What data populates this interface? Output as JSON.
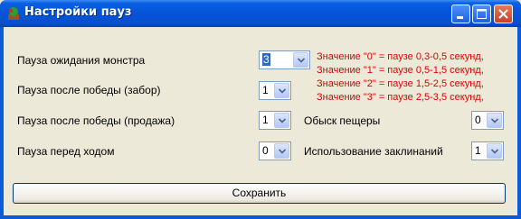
{
  "window": {
    "title": "Настройки пауз"
  },
  "settings": [
    {
      "label": "Пауза ожидания монстра",
      "value": "3"
    },
    {
      "label": "Пауза после победы (забор)",
      "value": "1"
    },
    {
      "label": "Пауза после победы (продажа)",
      "value": "1"
    },
    {
      "label": "Пауза перед ходом",
      "value": "0"
    },
    {
      "label": "Обыск пещеры",
      "value": "0"
    },
    {
      "label": "Использование заклинаний",
      "value": "1"
    }
  ],
  "note": [
    "Значение \"0\" = паузе 0,3-0,5 секунд,",
    "Значение \"1\" = паузе 0,5-1,5 секунд,",
    "Значение \"2\" = паузе 1,5-2,5 секунд,",
    "Значение \"3\" = паузе 2,5-3,5 секунд,"
  ],
  "save_label": "Сохранить",
  "colors": {
    "title_bar": "#0453d8",
    "note_text": "#e00000",
    "background": "#ece9d8"
  }
}
